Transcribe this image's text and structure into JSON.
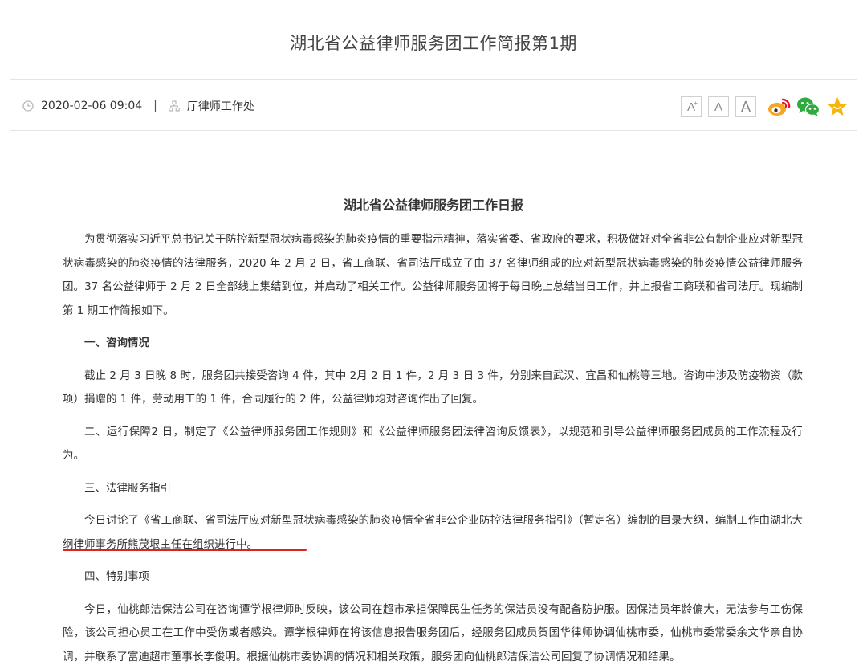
{
  "header": {
    "title": "湖北省公益律师服务团工作简报第1期",
    "date": "2020-02-06 09:04",
    "separator": "|",
    "source": "厅律师工作处"
  },
  "toolbar": {
    "font_large": "A",
    "font_large_sup": "+",
    "font_medium": "A",
    "font_small": "A",
    "icons": [
      "weibo-icon",
      "wechat-icon",
      "favorite-star-icon"
    ],
    "colors": {
      "weibo": "#e6162d",
      "weibo_accent": "#f5a623",
      "wechat": "#2fab3f",
      "star": "#f5b50a"
    }
  },
  "article": {
    "title": "湖北省公益律师服务团工作日报",
    "paragraphs": [
      "为贯彻落实习近平总书记关于防控新型冠状病毒感染的肺炎疫情的重要指示精神，落实省委、省政府的要求，积极做好对全省非公有制企业应对新型冠状病毒感染的肺炎疫情的法律服务，2020 年 2 月 2 日，省工商联、省司法厅成立了由 37 名律师组成的应对新型冠状病毒感染的肺炎疫情公益律师服务团。37 名公益律师于 2 月 2 日全部线上集结到位，并启动了相关工作。公益律师服务团将于每日晚上总结当日工作，并上报省工商联和省司法厅。现编制第 1 期工作简报如下。",
      "一、咨询情况",
      "截止 2 月 3 日晚 8 时，服务团共接受咨询 4 件，其中 2月 2 日 1 件，2 月 3 日 3 件，分别来自武汉、宜昌和仙桃等三地。咨询中涉及防疫物资（款项）捐赠的 1 件，劳动用工的 1 件，合同履行的 2 件，公益律师均对咨询作出了回复。",
      "二、运行保障2 日，制定了《公益律师服务团工作规则》和《公益律师服务团法律咨询反馈表》，以规范和引导公益律师服务团成员的工作流程及行为。",
      "三、法律服务指引",
      "今日讨论了《省工商联、省司法厅应对新型冠状病毒感染的肺炎疫情全省非公企业防控法律服务指引》（暂定名）编制的目录大纲，编制工作由湖北大纲律师事务所熊茂垠主任在组织进行中。",
      "四、特别事项",
      "今日，仙桃郎洁保洁公司在咨询谭学根律师时反映，该公司在超市承担保障民生任务的保洁员没有配备防护服。因保洁员年龄偏大，无法参与工伤保险，该公司担心员工在工作中受伤或者感染。谭学根律师在将该信息报告服务团后，经服务团成员贺国华律师协调仙桃市委，仙桃市委常委余文华亲自协调，并联系了富迪超市董事长李俊明。根据仙桃市委协调的情况和相关政策，服务团向仙桃郎洁保洁公司回复了协调情况和结果。"
    ],
    "highlight_color": "#d9261c"
  }
}
